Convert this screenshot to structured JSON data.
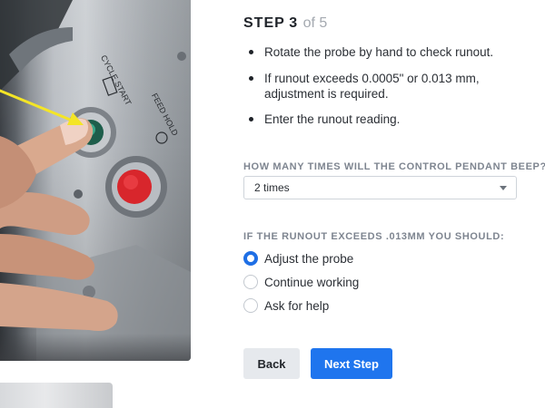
{
  "photo": {
    "panel_labels": [
      "CYCLE START",
      "FEED HOLD"
    ]
  },
  "step": {
    "word": "STEP",
    "number": "3",
    "of_text": "of 5"
  },
  "instructions": [
    "Rotate the probe by hand to check runout.",
    "If runout exceeds 0.0005\" or 0.013 mm, adjustment is required.",
    "Enter the runout reading."
  ],
  "question1": {
    "label": "HOW MANY TIMES WILL THE CONTROL PENDANT BEEP?",
    "selected": "2 times"
  },
  "question2": {
    "label": "IF THE RUNOUT EXCEEDS .013MM YOU SHOULD:",
    "options": [
      "Adjust the probe",
      "Continue working",
      "Ask for help"
    ],
    "selected_index": 0
  },
  "buttons": {
    "back": "Back",
    "next": "Next Step"
  },
  "colors": {
    "accent": "#1f75ee",
    "radio_selected": "#1f6fe5",
    "label_gray": "#7e8590",
    "arrow_yellow": "#f4e526",
    "start_button_green": "#2f9c7a",
    "hold_button_red": "#d8262c"
  }
}
